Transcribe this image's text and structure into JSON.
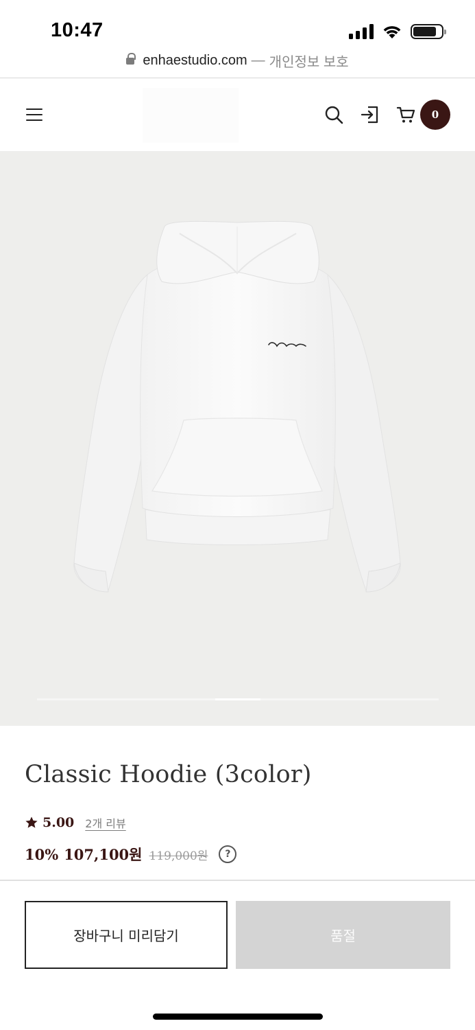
{
  "status_bar": {
    "time": "10:47",
    "icons": [
      "signal-icon",
      "wifi-icon",
      "battery-icon"
    ]
  },
  "browser": {
    "domain": "enhaestudio.com",
    "separator": "—",
    "privacy_label": "개인정보 보호"
  },
  "header": {
    "icons": [
      "menu-icon",
      "search-icon",
      "login-icon",
      "cart-icon"
    ],
    "cart_count": "0",
    "badge_color": "#3a1614"
  },
  "gallery": {
    "background_color": "#eeeeec",
    "image": "white hoodie",
    "current_slide": 5,
    "slide_count": 9
  },
  "product": {
    "title": "Classic Hoodie (3color)",
    "rating": "5.00",
    "review_link": "2개 리뷰",
    "discount": "10%",
    "sale_price": "107,100원",
    "original_price": "119,000원",
    "help_label": "?"
  },
  "actions": {
    "cart_button": "장바구니 미리담기",
    "soldout_button": "품절"
  }
}
